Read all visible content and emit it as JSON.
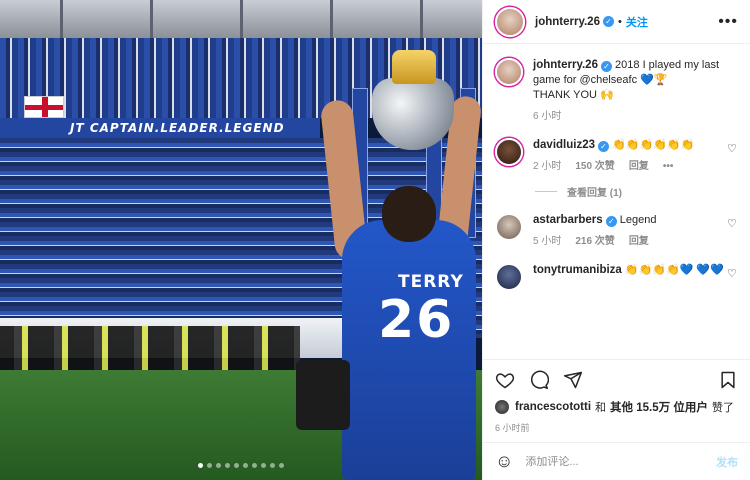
{
  "photo": {
    "banner_text": "JT CAPTAIN.LEADER.LEGEND",
    "shirt_name": "TERRY",
    "shirt_number": "26",
    "carousel_total": 10,
    "carousel_active": 0
  },
  "header": {
    "username": "johnterry.26",
    "follow_label": "关注",
    "more_label": "•••"
  },
  "caption": {
    "username": "johnterry.26",
    "text_line1": "2018 I played my last game for @chelseafc 💙🏆",
    "text_line2": "THANK YOU 🙌",
    "time": "6 小时"
  },
  "comments": [
    {
      "username": "davidluiz23",
      "text": "👏👏👏👏👏👏",
      "time": "2 小时",
      "likes": "150 次赞",
      "reply_label": "回复",
      "replies_label": "查看回复 (1)"
    },
    {
      "username": "astarbarbers",
      "text": "Legend",
      "time": "5 小时",
      "likes": "216 次赞",
      "reply_label": "回复"
    },
    {
      "username": "tonytrumanibiza",
      "text": "👏👏👏👏💙 💙💙"
    }
  ],
  "likes_line": {
    "user": "francescototti",
    "and_label": "和",
    "others": "其他 15.5万 位用户",
    "liked": "赞了"
  },
  "post_time": "6 小时前",
  "add_comment": {
    "placeholder": "添加评论...",
    "post_label": "发布"
  },
  "colors": {
    "accent": "#0095f6",
    "verified": "#3897f0",
    "post_disabled": "#b2dffc"
  }
}
